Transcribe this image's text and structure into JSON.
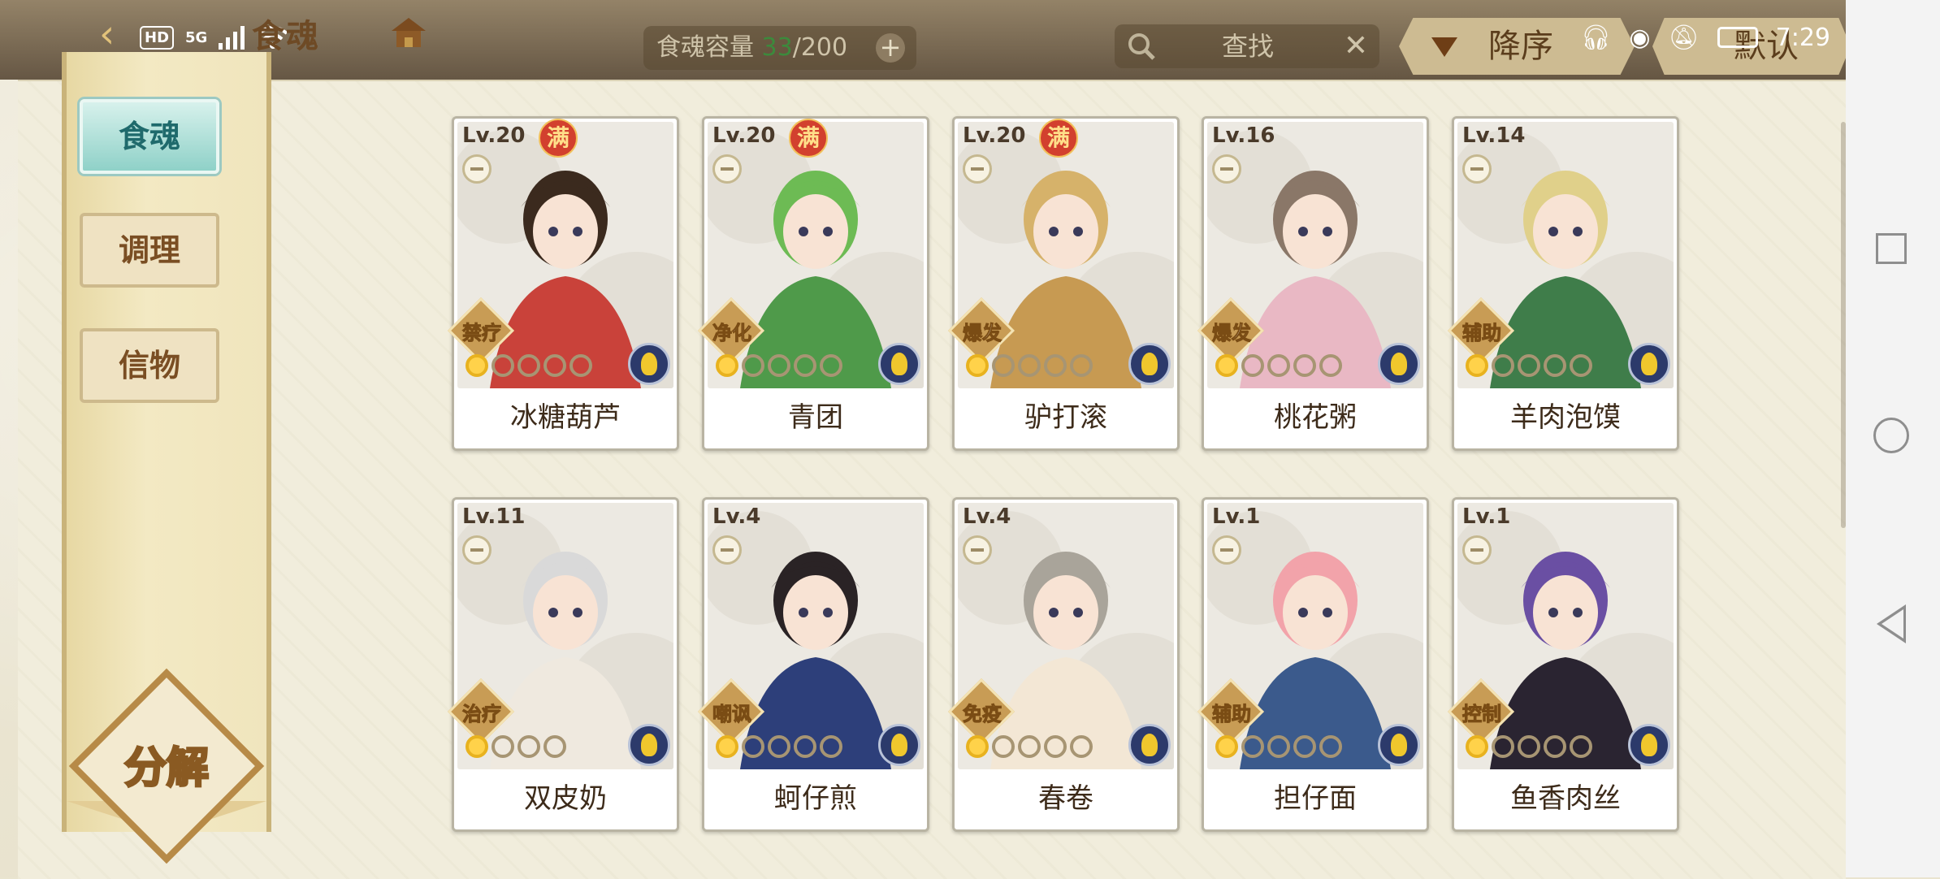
{
  "status_bar": {
    "hd": "HD",
    "network": "5G",
    "time": "7:29"
  },
  "header": {
    "title": "食魂",
    "capacity_label": "食魂容量",
    "capacity_current": "33",
    "capacity_max": "/200",
    "capacity_add": "+",
    "search_placeholder": "查找",
    "search_clear": "✕",
    "sort_label": "降序",
    "default_label": "默认"
  },
  "sidebar": {
    "items": [
      {
        "label": "食魂",
        "active": true
      },
      {
        "label": "调理",
        "active": false
      },
      {
        "label": "信物",
        "active": false
      }
    ],
    "decompose_label": "分解"
  },
  "cards": [
    {
      "name": "冰糖葫芦",
      "level": "Lv.20",
      "full": "满",
      "role": "禁疗",
      "stars_on": 1,
      "stars_total": 5,
      "bg": "#c9423a",
      "hair": "#3b2a1e"
    },
    {
      "name": "青团",
      "level": "Lv.20",
      "full": "满",
      "role": "净化",
      "stars_on": 1,
      "stars_total": 5,
      "bg": "#4f9a4a",
      "hair": "#6dbb54"
    },
    {
      "name": "驴打滚",
      "level": "Lv.20",
      "full": "满",
      "role": "爆发",
      "stars_on": 1,
      "stars_total": 5,
      "bg": "#c79a52",
      "hair": "#d6b26a"
    },
    {
      "name": "桃花粥",
      "level": "Lv.16",
      "full": "",
      "role": "爆发",
      "stars_on": 1,
      "stars_total": 5,
      "bg": "#e9b8c4",
      "hair": "#8a7768"
    },
    {
      "name": "羊肉泡馍",
      "level": "Lv.14",
      "full": "",
      "role": "辅助",
      "stars_on": 1,
      "stars_total": 5,
      "bg": "#3f7d4a",
      "hair": "#e0d08a"
    },
    {
      "name": "双皮奶",
      "level": "Lv.11",
      "full": "",
      "role": "治疗",
      "stars_on": 1,
      "stars_total": 4,
      "bg": "#efe9df",
      "hair": "#d9d9d9"
    },
    {
      "name": "蚵仔煎",
      "level": "Lv.4",
      "full": "",
      "role": "嘲讽",
      "stars_on": 1,
      "stars_total": 5,
      "bg": "#2d3f7a",
      "hair": "#2a2325"
    },
    {
      "name": "春卷",
      "level": "Lv.4",
      "full": "",
      "role": "免疫",
      "stars_on": 1,
      "stars_total": 5,
      "bg": "#f3e7d5",
      "hair": "#a9a49a"
    },
    {
      "name": "担仔面",
      "level": "Lv.1",
      "full": "",
      "role": "辅助",
      "stars_on": 1,
      "stars_total": 5,
      "bg": "#3b5a8c",
      "hair": "#f2a3aa"
    },
    {
      "name": "鱼香肉丝",
      "level": "Lv.1",
      "full": "",
      "role": "控制",
      "stars_on": 1,
      "stars_total": 5,
      "bg": "#2a2431",
      "hair": "#6a4fa3"
    }
  ],
  "colors": {
    "accent_teal": "#8fd1c8",
    "full_badge_red": "#d2402e",
    "role_gold": "#c89c55",
    "capacity_green": "#3c8a3c"
  }
}
